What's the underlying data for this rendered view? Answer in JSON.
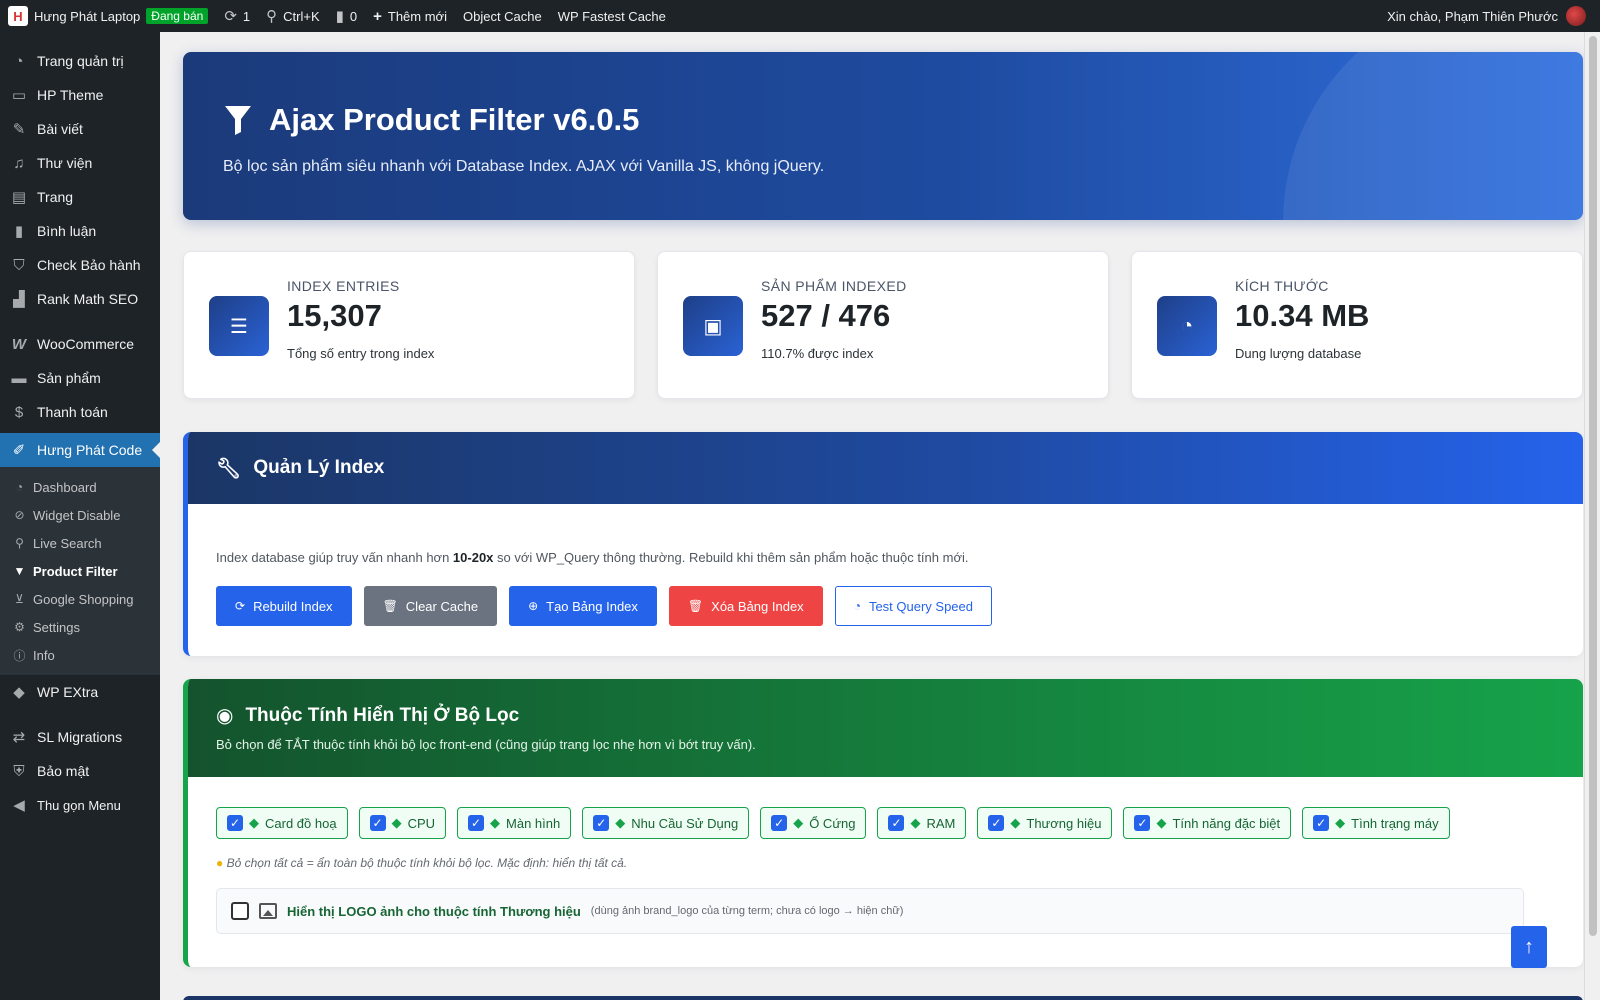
{
  "adminbar": {
    "site_name": "Hưng Phát Laptop",
    "status_badge": "Đang bán",
    "updates_count": "1",
    "search_shortcut": "Ctrl+K",
    "comments_count": "0",
    "new_label": "Thêm mới",
    "object_cache": "Object Cache",
    "wp_fastest_cache": "WP Fastest Cache",
    "greeting": "Xin chào, Phạm Thiên Phước"
  },
  "sidebar": {
    "items": [
      {
        "label": "Trang quản trị",
        "icon": "dashboard-icon"
      },
      {
        "label": "HP Theme",
        "icon": "theme-icon"
      },
      {
        "label": "Bài viết",
        "icon": "pin-icon"
      },
      {
        "label": "Thư viện",
        "icon": "media-icon"
      },
      {
        "label": "Trang",
        "icon": "pages-icon"
      },
      {
        "label": "Bình luận",
        "icon": "comment-icon"
      },
      {
        "label": "Check Bảo hành",
        "icon": "shield-icon"
      },
      {
        "label": "Rank Math SEO",
        "icon": "chart-icon"
      },
      {
        "label": "WooCommerce",
        "icon": "woo-icon"
      },
      {
        "label": "Sản phẩm",
        "icon": "archive-icon"
      },
      {
        "label": "Thanh toán",
        "icon": "dollar-icon"
      },
      {
        "label": "Hưng Phát Code",
        "icon": "code-icon"
      },
      {
        "label": "WP EXtra",
        "icon": "diamond-icon"
      },
      {
        "label": "SL Migrations",
        "icon": "migrate-icon"
      },
      {
        "label": "Bảo mật",
        "icon": "security-icon"
      },
      {
        "label": "Thu gọn Menu",
        "icon": "collapse-icon"
      }
    ],
    "submenu": [
      {
        "label": "Dashboard",
        "icon": "gauge-icon"
      },
      {
        "label": "Widget Disable",
        "icon": "eye-slash-icon"
      },
      {
        "label": "Live Search",
        "icon": "search-icon"
      },
      {
        "label": "Product Filter",
        "icon": "filter-icon"
      },
      {
        "label": "Google Shopping",
        "icon": "cart-icon"
      },
      {
        "label": "Settings",
        "icon": "gear-icon"
      },
      {
        "label": "Info",
        "icon": "info-icon"
      }
    ]
  },
  "hero": {
    "title": "Ajax Product Filter v6.0.5",
    "subtitle": "Bộ lọc sản phẩm siêu nhanh với Database Index. AJAX với Vanilla JS, không jQuery."
  },
  "stats": [
    {
      "label": "INDEX ENTRIES",
      "value": "15,307",
      "desc": "Tổng số entry trong index",
      "icon": "database-icon"
    },
    {
      "label": "SẢN PHẨM INDEXED",
      "value": "527 / 476",
      "desc": "110.7% được index",
      "icon": "bag-icon"
    },
    {
      "label": "KÍCH THƯỚC",
      "value": "10.34 MB",
      "desc": "Dung lượng database",
      "icon": "gauge-icon"
    }
  ],
  "index_card": {
    "title": "Quản Lý Index",
    "text_before": "Index database giúp truy vấn nhanh hơn ",
    "text_bold": "10-20x",
    "text_after": " so với WP_Query thông thường. Rebuild khi thêm sản phẩm hoặc thuộc tính mới.",
    "buttons": {
      "rebuild": "Rebuild Index",
      "clear": "Clear Cache",
      "create": "Tạo Bảng Index",
      "delete": "Xóa Bảng Index",
      "test": "Test Query Speed"
    }
  },
  "attrs_card": {
    "title": "Thuộc Tính Hiển Thị Ở Bộ Lọc",
    "subtitle": "Bỏ chọn để TẮT thuộc tính khỏi bộ lọc front-end (cũng giúp trang lọc nhẹ hơn vì bớt truy vấn).",
    "chips": [
      "Card đồ hoạ",
      "CPU",
      "Màn hình",
      "Nhu Cầu Sử Dụng",
      "Ổ Cứng",
      "RAM",
      "Thương hiệu",
      "Tính năng đặc biệt",
      "Tình trạng máy"
    ],
    "hint": "Bỏ chọn tất cả = ẩn toàn bộ thuộc tính khỏi bộ lọc. Mặc định: hiển thị tất cả.",
    "logo_option_title": "Hiển thị LOGO ảnh cho thuộc tính Thương hiệu",
    "logo_option_note": "(dùng ảnh brand_logo của từng term; chưa có logo → hiện chữ)"
  },
  "colors": {
    "accent_blue": "#2563eb",
    "accent_green": "#16a34a",
    "danger": "#ef4444",
    "wp_admin": "#1d2327"
  }
}
